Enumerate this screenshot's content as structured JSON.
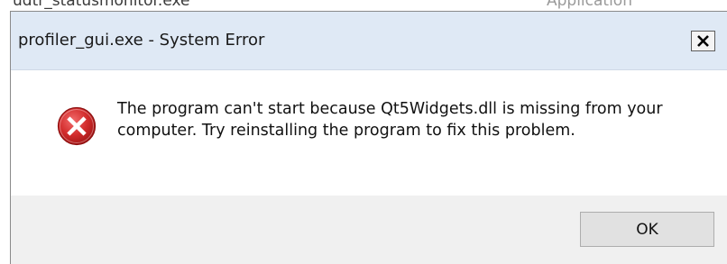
{
  "background": {
    "file_name": "udtr_statusmonitor.exe",
    "file_type": "Application"
  },
  "dialog": {
    "title": "profiler_gui.exe - System Error",
    "close_glyph": "✕",
    "close_icon": "close-icon",
    "status_icon": "error-icon",
    "message_line1": "The program can't start because Qt5Widgets.dll is missing from your",
    "message_line2": "computer. Try reinstalling the program to fix this problem.",
    "ok_label": "OK"
  },
  "colors": {
    "titlebar": "#dfe9f5",
    "error_red": "#d22c2c",
    "footer": "#f0f0f0"
  }
}
